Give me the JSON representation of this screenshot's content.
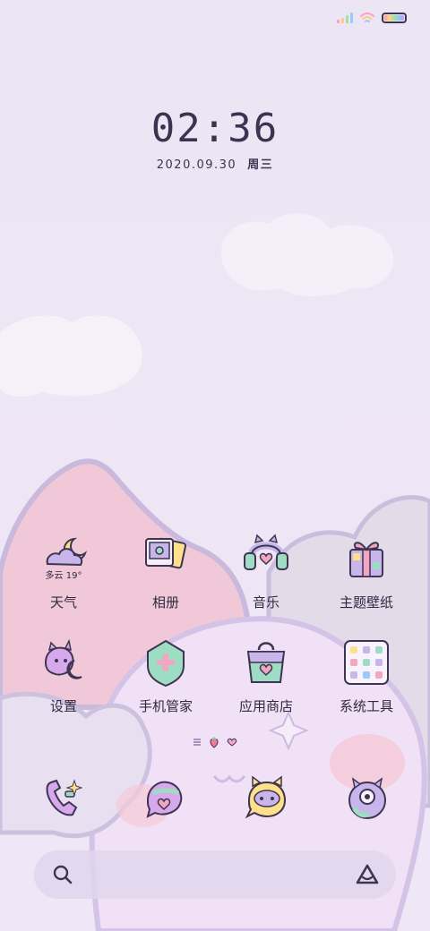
{
  "status_bar": {
    "signal_colors": [
      "#ff9fb9",
      "#ffc98a",
      "#a6e29f",
      "#9ac9ff"
    ],
    "wifi_icon": "wifi-icon",
    "battery_icon": "battery-icon"
  },
  "lockclock": {
    "time": "02:36",
    "date": "2020.09.30",
    "weekday": "周三"
  },
  "weather": {
    "condition": "多云",
    "temperature": "19°"
  },
  "apps": [
    {
      "label": "天气",
      "icon": "weather-icon"
    },
    {
      "label": "相册",
      "icon": "gallery-icon"
    },
    {
      "label": "音乐",
      "icon": "headphones-icon"
    },
    {
      "label": "主题壁纸",
      "icon": "gift-box-icon"
    },
    {
      "label": "设置",
      "icon": "settings-icon"
    },
    {
      "label": "手机管家",
      "icon": "shield-icon"
    },
    {
      "label": "应用商店",
      "icon": "shopping-bag-icon"
    },
    {
      "label": "系统工具",
      "icon": "tools-folder-icon"
    }
  ],
  "dock": [
    {
      "icon": "phone-icon"
    },
    {
      "icon": "messages-icon"
    },
    {
      "icon": "chat-bubble-icon"
    },
    {
      "icon": "camera-monster-icon"
    }
  ],
  "page_indicator": {
    "icons": [
      "menu-lines-icon",
      "strawberry-icon",
      "heart-icon"
    ],
    "active_index": 1
  },
  "search": {
    "icon": "search-icon",
    "assistant_icon": "assistant-icon"
  },
  "colors": {
    "background": "#ece5f4",
    "text": "#2f2a40",
    "outline": "#3d3552",
    "pink": "#f3b6cd",
    "lilac": "#c8b6ea",
    "mint": "#9fdcc4",
    "yellow": "#ffe08a"
  }
}
